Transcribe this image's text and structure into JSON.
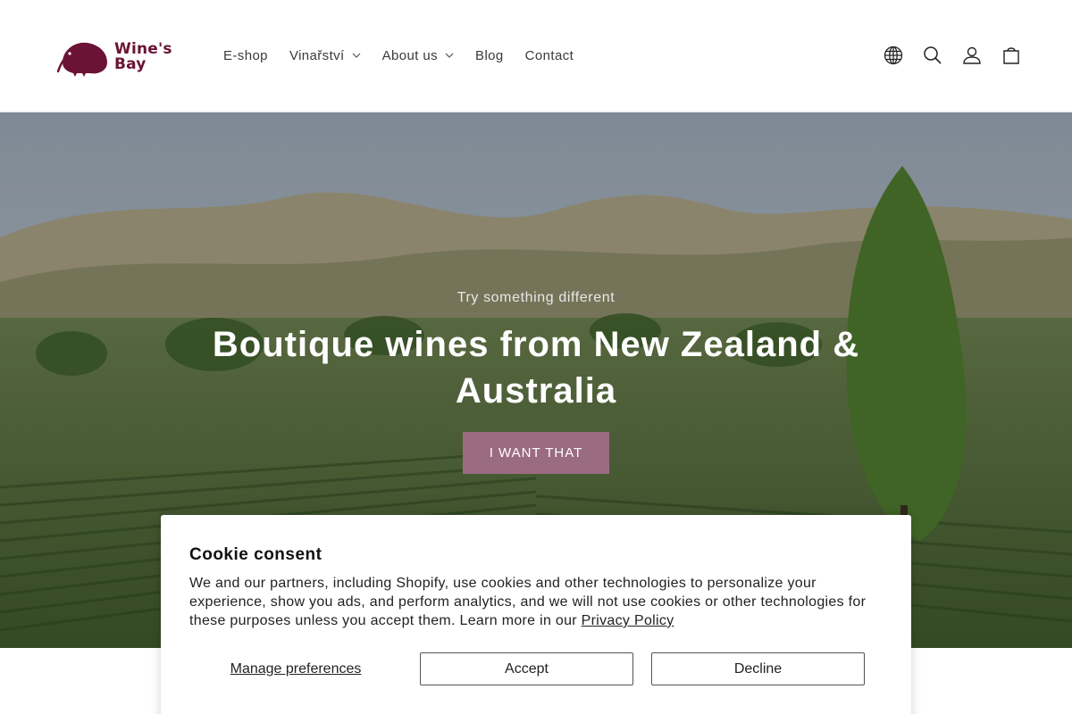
{
  "header": {
    "logo_text_line1": "Wine's",
    "logo_text_line2": "Bay",
    "nav": [
      {
        "label": "E-shop",
        "dropdown": false
      },
      {
        "label": "Vinařství",
        "dropdown": true
      },
      {
        "label": "About us",
        "dropdown": true
      },
      {
        "label": "Blog",
        "dropdown": false
      },
      {
        "label": "Contact",
        "dropdown": false
      }
    ],
    "icons": [
      "globe-icon",
      "search-icon",
      "account-icon",
      "cart-icon"
    ]
  },
  "hero": {
    "subtitle": "Try something different",
    "title": "Boutique wines from New Zealand & Australia",
    "button_label": "I WANT THAT"
  },
  "cookie": {
    "title": "Cookie consent",
    "text": "We and our partners, including Shopify, use cookies and other technologies to personalize your experience, show you ads, and perform analytics, and we will not use cookies or other technologies for these purposes unless you accept them. Learn more in our ",
    "link_label": "Privacy Policy",
    "manage_label": "Manage preferences",
    "accept_label": "Accept",
    "decline_label": "Decline"
  },
  "colors": {
    "brand": "#6b1335",
    "button": "#9b6b82"
  }
}
